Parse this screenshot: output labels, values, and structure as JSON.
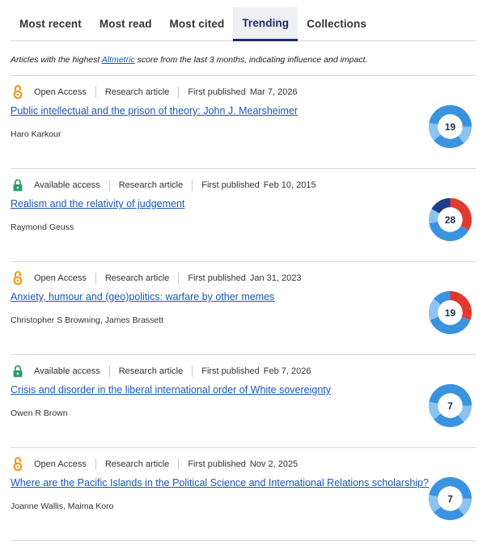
{
  "tabs": [
    {
      "label": "Most recent",
      "active": false
    },
    {
      "label": "Most read",
      "active": false
    },
    {
      "label": "Most cited",
      "active": false
    },
    {
      "label": "Trending",
      "active": true
    },
    {
      "label": "Collections",
      "active": false
    }
  ],
  "description": {
    "prefix": "Articles with the highest ",
    "link": "Altmetric",
    "suffix": " score from the last 3 months, indicating influence and impact."
  },
  "colors": {
    "link": "#1a57b8",
    "open_access": "#f29a1f",
    "available_access": "#2e9e6b",
    "altmetric_blue": "#3b93e0",
    "altmetric_red": "#e03a2e",
    "altmetric_navy": "#1d3f8a"
  },
  "articles": [
    {
      "access_icon": "open-access-icon",
      "access": "Open Access",
      "type": "Research article",
      "published_label": "First published",
      "published_date": "Mar 7, 2026",
      "title": "Public intellectual and the prison of theory: John J. Mearsheimer",
      "authors": "Haro Karkour",
      "score": "19",
      "ring": "blue"
    },
    {
      "access_icon": "lock-icon",
      "access": "Available access",
      "type": "Research article",
      "published_label": "First published",
      "published_date": "Feb 10, 2015",
      "title": "Realism and the relativity of judgement",
      "authors": "Raymond Geuss",
      "score": "28",
      "ring": "red-blue-navy"
    },
    {
      "access_icon": "open-access-icon",
      "access": "Open Access",
      "type": "Research article",
      "published_label": "First published",
      "published_date": "Jan 31, 2023",
      "title": "Anxiety, humour and (geo)politics: warfare by other memes",
      "authors": "Christopher S Browning, James Brassett",
      "score": "19",
      "ring": "red-blue"
    },
    {
      "access_icon": "lock-icon",
      "access": "Available access",
      "type": "Research article",
      "published_label": "First published",
      "published_date": "Feb 7, 2026",
      "title": "Crisis and disorder in the liberal international order of White sovereignty",
      "authors": "Owen R Brown",
      "score": "7",
      "ring": "blue"
    },
    {
      "access_icon": "open-access-icon",
      "access": "Open Access",
      "type": "Research article",
      "published_label": "First published",
      "published_date": "Nov 2, 2025",
      "title": "Where are the Pacific Islands in the Political Science and International Relations scholarship?",
      "authors": "Joanne Wallis, Maima Koro",
      "score": "7",
      "ring": "blue"
    }
  ]
}
